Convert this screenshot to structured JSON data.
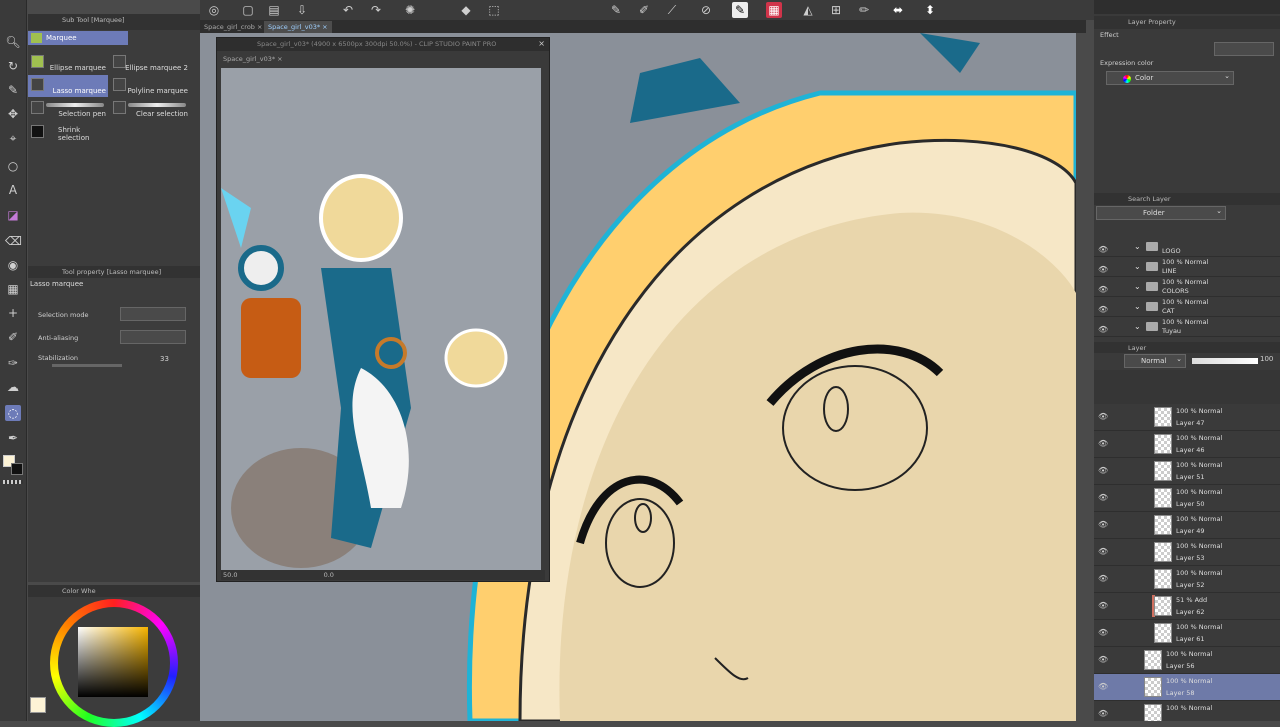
{
  "colors": {
    "accent": "#6d7bb8",
    "canvas_bg": "#8a9099"
  },
  "subtool_panel": {
    "title": "Sub Tool [Marquee]",
    "group_label": "Marquee",
    "tools": [
      {
        "label": "Ellipse marquee",
        "icon": "ellipse-marquee-icon"
      },
      {
        "label": "Ellipse marquee 2",
        "icon": "ellipse-marquee-icon"
      },
      {
        "label": "Lasso marquee",
        "icon": "lasso-icon"
      },
      {
        "label": "Polyline marquee",
        "icon": "polyline-icon"
      },
      {
        "label": "Selection pen",
        "icon": "selection-pen-icon"
      },
      {
        "label": "Clear selection",
        "icon": "clear-selection-icon"
      },
      {
        "label": "Shrink selection",
        "icon": "shrink-selection-icon"
      }
    ]
  },
  "tool_property": {
    "title": "Tool property [Lasso marquee]",
    "tool_name": "Lasso marquee",
    "selection_mode_label": "Selection mode",
    "anti_aliasing_label": "Anti-aliasing",
    "stabilization_label": "Stabilization",
    "stabilization_value": "33"
  },
  "color_wheel": {
    "title": "Color Whe"
  },
  "tabs": [
    {
      "label": "Space_girl_crob"
    },
    {
      "label": "Space_girl_v03*"
    }
  ],
  "nav_window": {
    "title": "Space_girl_v03* (4900 x 6500px 300dpi 50.0%) - CLIP STUDIO PAINT PRO",
    "tab": "Space_girl_v03*",
    "zoom": "50.0",
    "angle": "0.0"
  },
  "right_panel": {
    "layer_property_title": "Layer Property",
    "effect_label": "Effect",
    "expression_color_label": "Expression color",
    "expression_color_value": "Color",
    "search_layer_title": "Search Layer",
    "folder_dropdown": "Folder",
    "layer_title": "Layer",
    "blend_mode": "Normal",
    "opacity": "100"
  },
  "search_folders": [
    {
      "blend": "",
      "name": "LOGO"
    },
    {
      "blend": "100 % Normal",
      "name": "LINE"
    },
    {
      "blend": "100 % Normal",
      "name": "COLORS"
    },
    {
      "blend": "100 % Normal",
      "name": "CAT"
    },
    {
      "blend": "100 % Normal",
      "name": "Tuyau"
    }
  ],
  "layers": [
    {
      "blend": "100 % Normal",
      "name": "Layer 47"
    },
    {
      "blend": "100 % Normal",
      "name": "Layer 46"
    },
    {
      "blend": "100 % Normal",
      "name": "Layer 51"
    },
    {
      "blend": "100 % Normal",
      "name": "Layer 50"
    },
    {
      "blend": "100 % Normal",
      "name": "Layer 49"
    },
    {
      "blend": "100 % Normal",
      "name": "Layer 53"
    },
    {
      "blend": "100 % Normal",
      "name": "Layer 52"
    },
    {
      "blend": "51 % Add",
      "name": "Layer 62"
    },
    {
      "blend": "100 % Normal",
      "name": "Layer 61"
    },
    {
      "blend": "100 % Normal",
      "name": "Layer 56"
    },
    {
      "blend": "100 % Normal",
      "name": "Layer 58"
    },
    {
      "blend": "100 % Normal",
      "name": ""
    }
  ]
}
